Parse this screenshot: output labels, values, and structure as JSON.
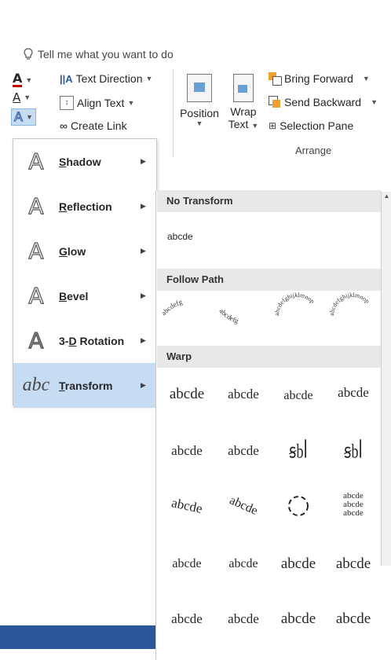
{
  "tell_me": {
    "text": "Tell me what you want to do"
  },
  "ribbon": {
    "text_direction": "Text Direction",
    "align_text": "Align Text",
    "create_link": "Create Link",
    "position": "Position",
    "wrap_text_line1": "Wrap",
    "wrap_text_line2": "Text",
    "bring_forward": "Bring Forward",
    "send_backward": "Send Backward",
    "selection_pane": "Selection Pane",
    "arrange_group": "Arrange"
  },
  "effects_menu": {
    "items": [
      {
        "label": "Shadow",
        "accel": "S",
        "rest": "hadow"
      },
      {
        "label": "Reflection",
        "accel": "R",
        "rest": "eflection"
      },
      {
        "label": "Glow",
        "accel": "G",
        "rest": "low"
      },
      {
        "label": "Bevel",
        "accel": "B",
        "rest": "evel"
      },
      {
        "label": "3-D Rotation",
        "prefix": "3-",
        "accel": "D",
        "rest": " Rotation"
      },
      {
        "label": "Transform",
        "accel": "T",
        "rest": "ransform",
        "selected": true
      }
    ]
  },
  "gallery": {
    "sections": {
      "no_transform": "No Transform",
      "follow_path": "Follow Path",
      "warp": "Warp"
    },
    "no_transform_sample": "abcde",
    "warp_sample": "abcde",
    "follow_path_samples": [
      "abcdefg",
      "abcdefg",
      "abcdefghijklmnop",
      "abcdefghijklmnop"
    ]
  },
  "colors": {
    "selected_bg": "#c5dcf3",
    "section_header_bg": "#e8e8e8",
    "accent_blue": "#2b579a"
  }
}
